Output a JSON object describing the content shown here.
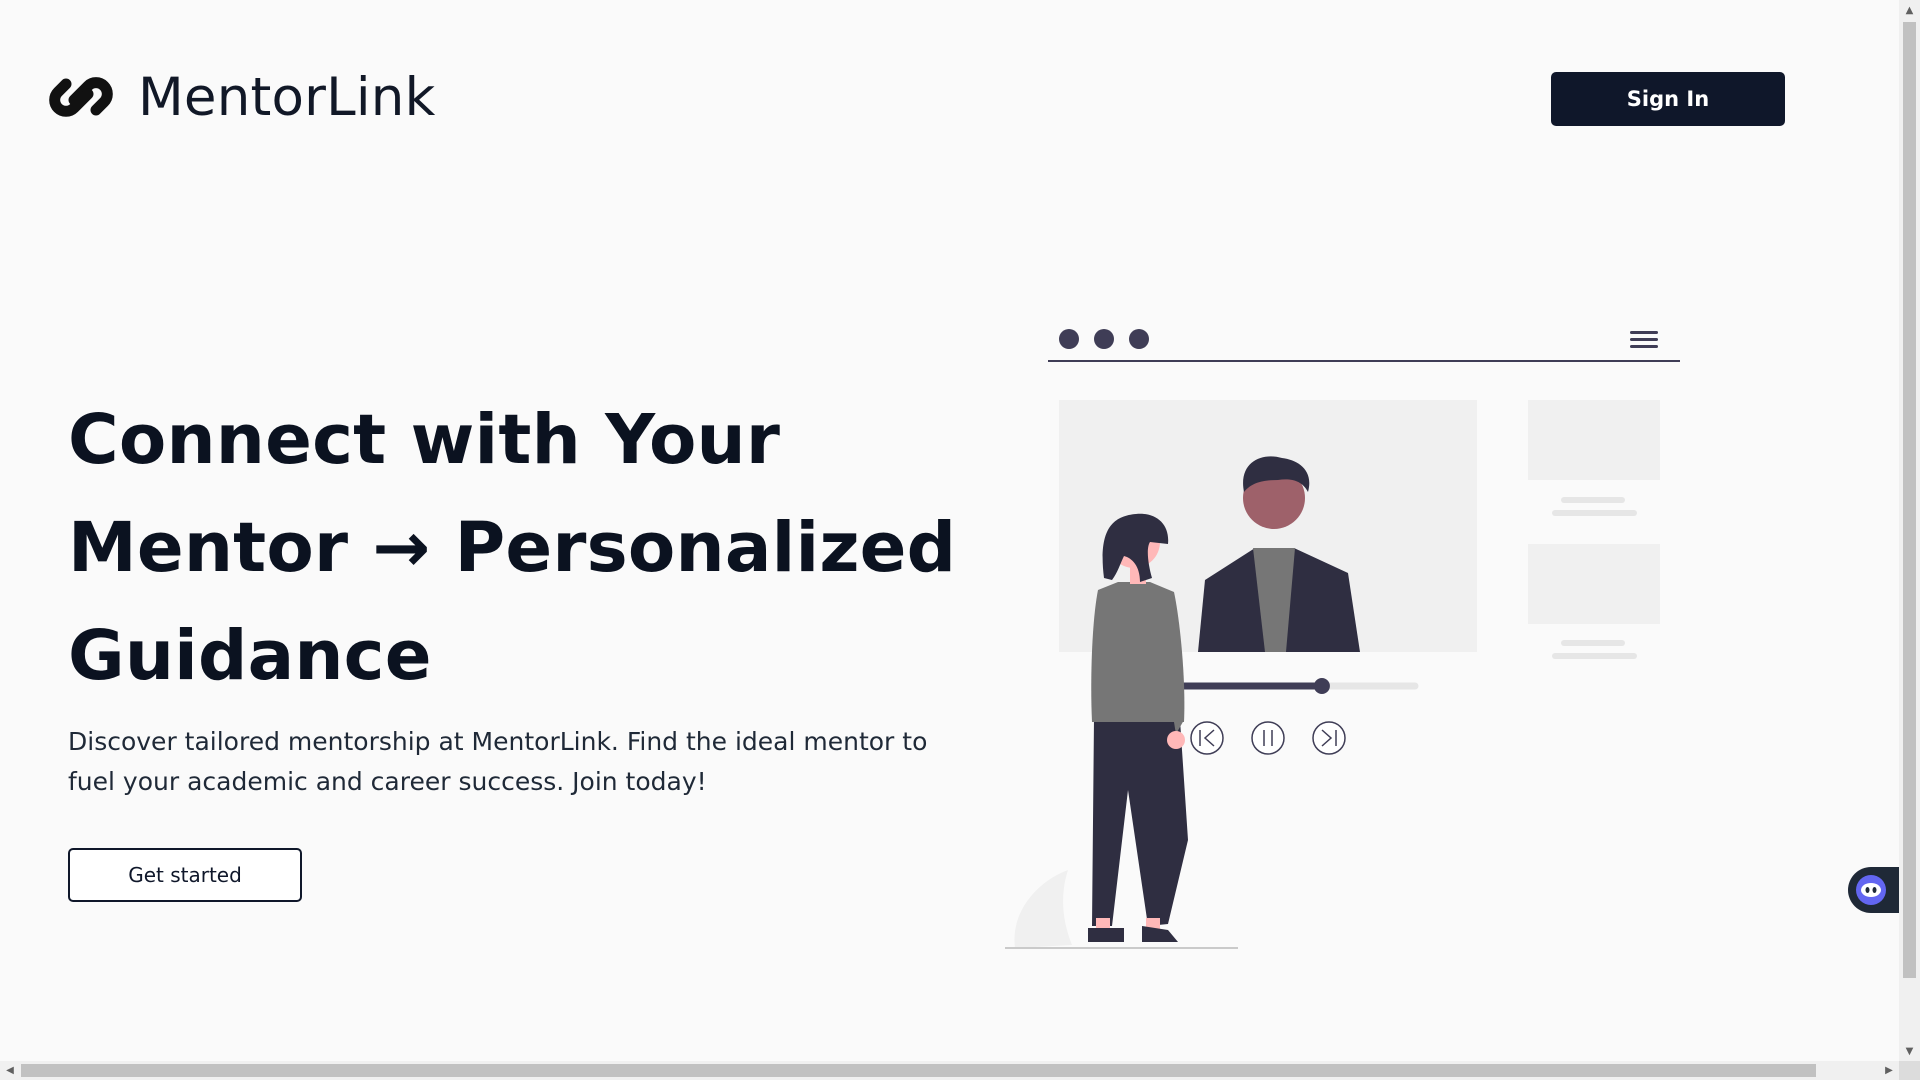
{
  "brand": {
    "name": "MentorLink",
    "logo_icon": "chain-link-icon"
  },
  "header": {
    "signin_label": "Sign In"
  },
  "hero": {
    "title": "Connect with Your Mentor → Personalized Guidance",
    "description": "Discover tailored mentorship at MentorLink. Find the ideal mentor to fuel your academic and career success. Join today!",
    "cta_label": "Get started"
  },
  "illustration": {
    "icon": "video-mentoring-illustration",
    "progress": 0.62
  },
  "widgets": {
    "chat_icon": "chat-bot-icon"
  },
  "colors": {
    "primary": "#0f172a",
    "background": "#fafafa",
    "illustration_dark": "#3f3d56",
    "illustration_gray": "#f0f0f0"
  }
}
